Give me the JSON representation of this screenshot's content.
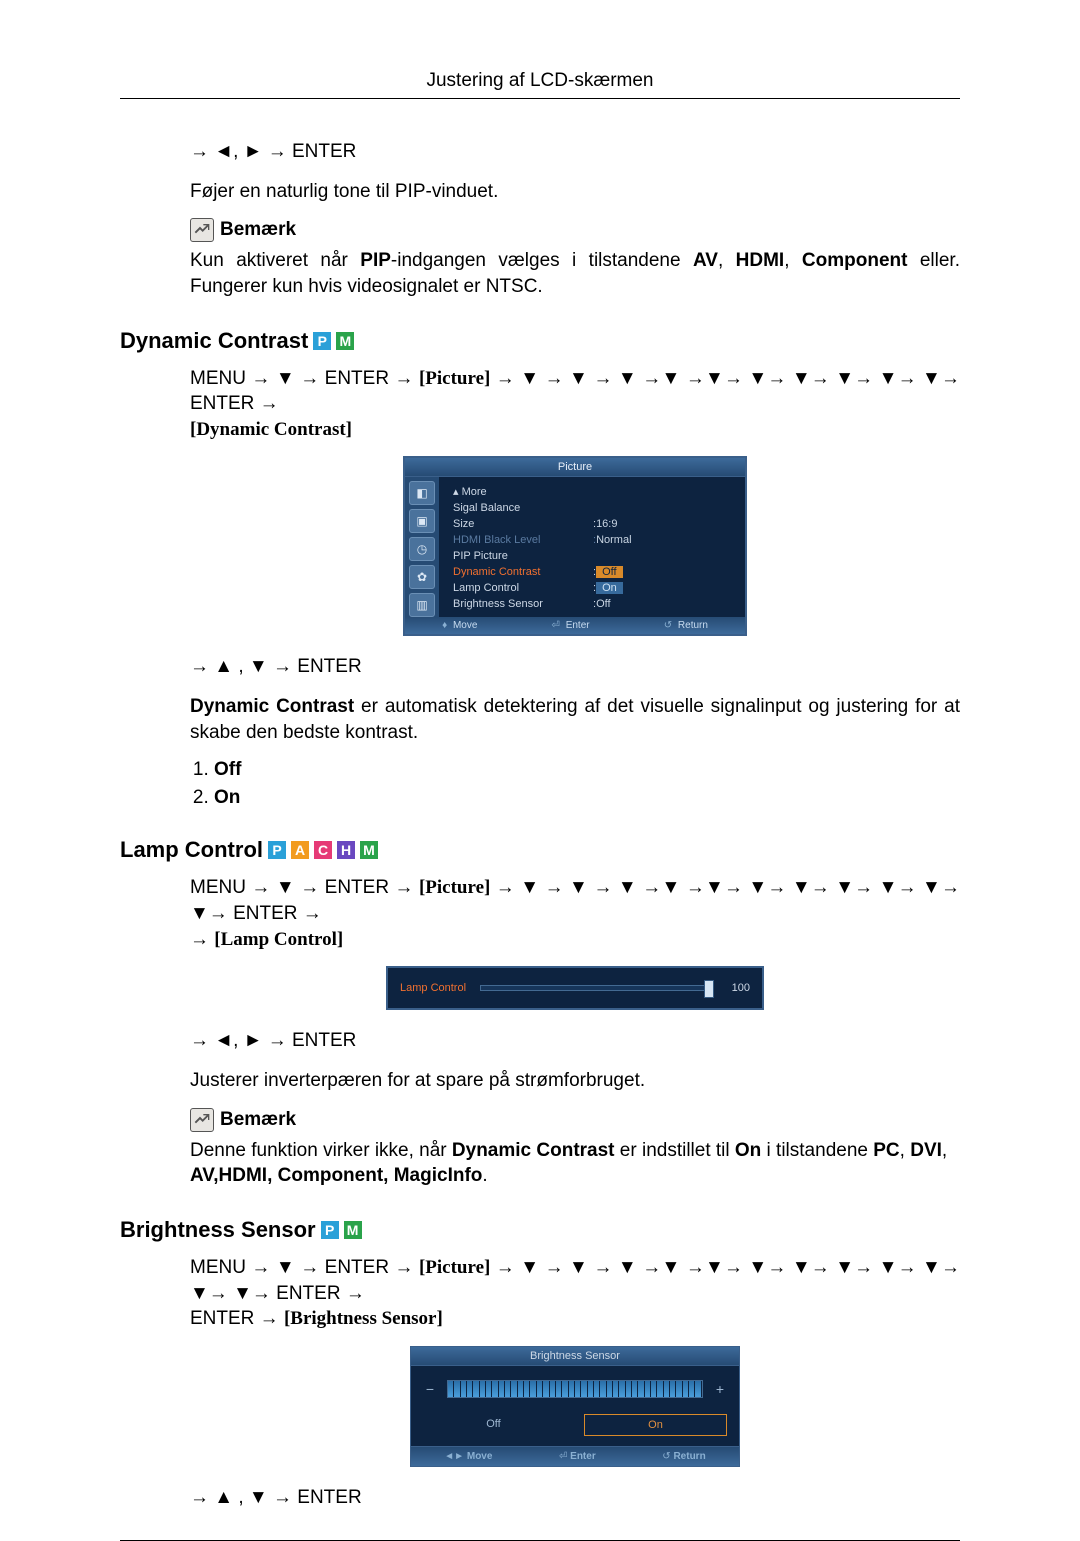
{
  "header": {
    "title": "Justering af LCD-skærmen"
  },
  "sec0": {
    "nav": "→ ◄, ► → ENTER",
    "intro": "Føjer en naturlig tone til PIP-vinduet.",
    "note_label": "Bemærk",
    "note_pre": "Kun aktiveret når ",
    "note_b1": "PIP",
    "note_mid": "-indgangen vælges i tilstandene ",
    "note_b2": "AV",
    "note_b3": "HDMI",
    "note_b4": "Component",
    "note_post": " eller. Fungerer kun hvis videosignalet er NTSC."
  },
  "sec1": {
    "title": "Dynamic Contrast",
    "tags": [
      "P",
      "M"
    ],
    "path_menu": "MENU → ▼ → ENTER → ",
    "path_picture": "[Picture]",
    "path_arrows": " → ▼ → ▼ → ▼ →▼ →▼→ ▼→ ▼→ ▼→ ▼→ ▼→ ENTER → ",
    "path_target": "[Dynamic Contrast]",
    "osd": {
      "title": "Picture",
      "rows": [
        {
          "label": "More",
          "value": "",
          "kind": "more"
        },
        {
          "label": "Sigal Balance",
          "value": ""
        },
        {
          "label": "Size",
          "value": "16:9"
        },
        {
          "label": "HDMI Black Level",
          "value": "Normal",
          "kind": "dim"
        },
        {
          "label": "PIP Picture",
          "value": ""
        },
        {
          "label": "Dynamic Contrast",
          "value": "Off",
          "kind": "hl",
          "valkind": "sel"
        },
        {
          "label": "Lamp Control",
          "value": "On",
          "valkind": "on"
        },
        {
          "label": "Brightness Sensor",
          "value": "Off"
        }
      ],
      "footer": {
        "move": "Move",
        "enter": "Enter",
        "return": "Return"
      }
    },
    "nav2": "→ ▲ , ▼ → ENTER",
    "desc_b": "Dynamic Contrast",
    "desc": " er automatisk detektering af det visuelle signalinput og justering for at skabe den bedste kontrast.",
    "opts": [
      "Off",
      "On"
    ]
  },
  "sec2": {
    "title": "Lamp Control",
    "tags": [
      "P",
      "A",
      "C",
      "H",
      "M"
    ],
    "path_menu": "MENU → ▼ → ENTER → ",
    "path_picture": "[Picture]",
    "path_arrows": " → ▼ → ▼ → ▼ →▼ →▼→ ▼→ ▼→ ▼→ ▼→ ▼→ ▼→ ENTER → ",
    "path_target": "[Lamp Control]",
    "osd": {
      "label": "Lamp Control",
      "value": "100"
    },
    "nav2": "→ ◄, ► → ENTER",
    "desc": "Justerer inverterpæren for at spare på strømforbruget.",
    "note_label": "Bemærk",
    "note_pre": "Denne funktion virker ikke, når ",
    "note_b1": "Dynamic Contrast",
    "note_mid": " er indstillet til ",
    "note_b2": "On",
    "note_mid2": " i tilstandene ",
    "note_b3": "PC",
    "note_b4": "DVI",
    "note_line2": "AV,HDMI, Component, MagicInfo",
    "note_end": "."
  },
  "sec3": {
    "title": "Brightness Sensor",
    "tags": [
      "P",
      "M"
    ],
    "path_menu": "MENU → ▼ → ENTER → ",
    "path_picture": "[Picture]",
    "path_arrows": " → ▼ → ▼ → ▼ →▼ →▼→ ▼→ ▼→ ▼→ ▼→ ▼→ ▼→ ▼→ ENTER → ",
    "path_target": "[Brightness Sensor]",
    "osd": {
      "title": "Brightness Sensor",
      "off": "Off",
      "on": "On",
      "footer": {
        "move": "Move",
        "enter": "Enter",
        "return": "Return"
      }
    },
    "nav2": "→ ▲ , ▼ → ENTER"
  }
}
